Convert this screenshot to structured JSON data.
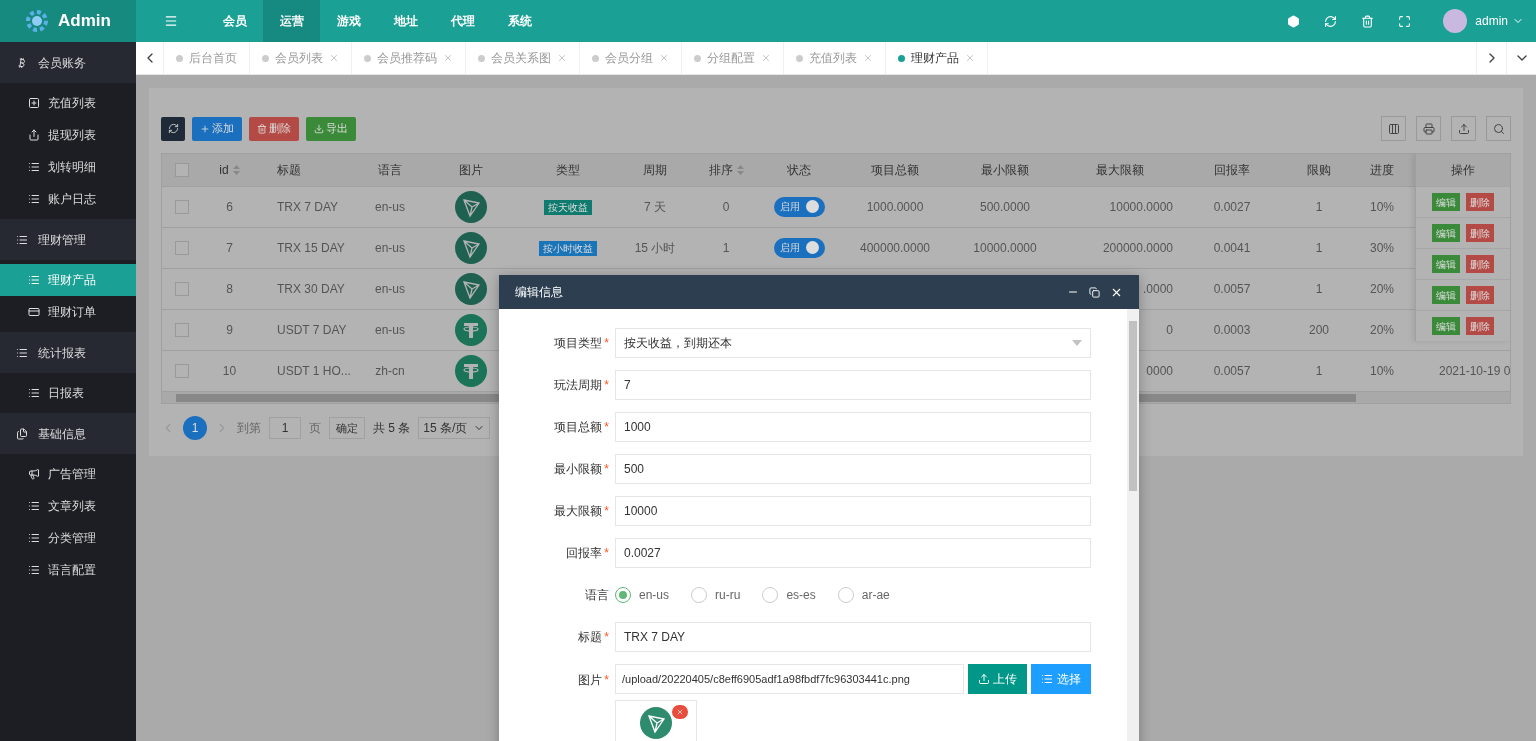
{
  "header": {
    "logo": "Admin",
    "nav": [
      {
        "label": "会员",
        "selected": false
      },
      {
        "label": "运营",
        "selected": true
      },
      {
        "label": "游戏",
        "selected": false
      },
      {
        "label": "地址",
        "selected": false
      },
      {
        "label": "代理",
        "selected": false
      },
      {
        "label": "系统",
        "selected": false
      }
    ],
    "user": "admin"
  },
  "tabs": [
    {
      "label": "后台首页",
      "selected": false,
      "closable": false
    },
    {
      "label": "会员列表",
      "selected": false,
      "closable": true
    },
    {
      "label": "会员推荐码",
      "selected": false,
      "closable": true
    },
    {
      "label": "会员关系图",
      "selected": false,
      "closable": true
    },
    {
      "label": "会员分组",
      "selected": false,
      "closable": true
    },
    {
      "label": "分组配置",
      "selected": false,
      "closable": true
    },
    {
      "label": "充值列表",
      "selected": false,
      "closable": true
    },
    {
      "label": "理财产品",
      "selected": true,
      "closable": true
    }
  ],
  "sidebar": [
    {
      "label": "会员账务",
      "children": [
        {
          "label": "充值列表",
          "selected": false
        },
        {
          "label": "提现列表",
          "selected": false
        },
        {
          "label": "划转明细",
          "selected": false
        },
        {
          "label": "账户日志",
          "selected": false
        }
      ]
    },
    {
      "label": "理财管理",
      "children": [
        {
          "label": "理财产品",
          "selected": true
        },
        {
          "label": "理财订单",
          "selected": false
        }
      ]
    },
    {
      "label": "统计报表",
      "children": [
        {
          "label": "日报表",
          "selected": false
        }
      ]
    },
    {
      "label": "基础信息",
      "children": [
        {
          "label": "广告管理",
          "selected": false
        },
        {
          "label": "文章列表",
          "selected": false
        },
        {
          "label": "分类管理",
          "selected": false
        },
        {
          "label": "语言配置",
          "selected": false
        }
      ]
    }
  ],
  "toolbar": [
    {
      "kind": "add",
      "label": "添加"
    },
    {
      "kind": "delete",
      "label": "删除"
    },
    {
      "kind": "export",
      "label": "导出"
    }
  ],
  "table": {
    "select_all_checked": false,
    "columns": [
      {
        "label": "id",
        "sortable": true
      },
      {
        "label": "标题",
        "sortable": false
      },
      {
        "label": "语言",
        "sortable": false
      },
      {
        "label": "图片",
        "sortable": false
      },
      {
        "label": "类型",
        "sortable": false
      },
      {
        "label": "周期",
        "sortable": false
      },
      {
        "label": "排序",
        "sortable": true
      },
      {
        "label": "状态",
        "sortable": false
      },
      {
        "label": "项目总额",
        "sortable": false
      },
      {
        "label": "最小限额",
        "sortable": false
      },
      {
        "label": "最大限额",
        "sortable": false
      },
      {
        "label": "回报率",
        "sortable": false
      },
      {
        "label": "限购",
        "sortable": false
      },
      {
        "label": "进度",
        "sortable": false
      },
      {
        "label": "操作",
        "sortable": false
      }
    ],
    "rows": [
      {
        "checked": false,
        "id": "6",
        "title": "TRX 7 DAY",
        "lang": "en-us",
        "type": {
          "label": "按天收益",
          "color": "#0f7a6e"
        },
        "period": "7 天",
        "sort": "0",
        "status": {
          "label": "启用",
          "on": true
        },
        "total": "1000.0000",
        "min": "500.0000",
        "max": "10000.0000",
        "rate": "0.0027",
        "limit": "1",
        "progress": "10%"
      },
      {
        "checked": false,
        "id": "7",
        "title": "TRX 15 DAY",
        "lang": "en-us",
        "type": {
          "label": "按小时收益",
          "color": "#1a74b8"
        },
        "period": "15 小时",
        "sort": "1",
        "status": {
          "label": "启用",
          "on": true
        },
        "total": "400000.0000",
        "min": "10000.0000",
        "max": "200000.0000",
        "rate": "0.0041",
        "limit": "1",
        "progress": "30%"
      },
      {
        "checked": false,
        "id": "8",
        "title": "TRX 30 DAY",
        "lang": "en-us",
        "max": ".0000",
        "rate": "0.0057",
        "limit": "1",
        "progress": "20%"
      },
      {
        "checked": false,
        "id": "9",
        "title": "USDT 7 DAY",
        "lang": "en-us",
        "max": "0",
        "rate": "0.0003",
        "limit": "200",
        "progress": "20%"
      },
      {
        "checked": false,
        "id": "10",
        "title": "USDT 1 HO...",
        "lang": "zh-cn",
        "max": "0000",
        "rate": "0.0057",
        "limit": "1",
        "progress": "10%",
        "column_15": "2021-10-19 0"
      }
    ],
    "actions": [
      {
        "edit": "编辑",
        "delete": "删除"
      },
      {
        "edit": "编辑",
        "delete": "删除"
      },
      {
        "edit": "编辑",
        "delete": "删除"
      },
      {
        "edit": "编辑",
        "delete": "删除"
      },
      {
        "edit": "编辑",
        "delete": "删除"
      }
    ]
  },
  "pagination": {
    "current": "1",
    "goto": "到第",
    "page_input": "1",
    "page_unit": "页",
    "confirm": "确定",
    "total": "共 5 条",
    "page_size": "15 条/页"
  },
  "modal": {
    "title": "编辑信息",
    "fields": [
      {
        "kind": "select",
        "label": "项目类型",
        "required_mark": "*",
        "value": "按天收益，到期还本"
      },
      {
        "kind": "input",
        "label": "玩法周期",
        "required_mark": "*",
        "value": "7"
      },
      {
        "kind": "input",
        "label": "项目总额",
        "required_mark": "*",
        "value": "1000"
      },
      {
        "kind": "input",
        "label": "最小限额",
        "required_mark": "*",
        "value": "500"
      },
      {
        "kind": "input",
        "label": "最大限额",
        "required_mark": "*",
        "value": "10000"
      },
      {
        "kind": "input",
        "label": "回报率",
        "required_mark": "*",
        "value": "0.0027"
      },
      {
        "kind": "radio",
        "label": "语言",
        "options": [
          {
            "label": "en-us",
            "selected": true
          },
          {
            "label": "ru-ru",
            "selected": false
          },
          {
            "label": "es-es",
            "selected": false
          },
          {
            "label": "ar-ae",
            "selected": false
          }
        ]
      },
      {
        "kind": "input",
        "label": "标题",
        "required_mark": "*",
        "value": "TRX 7 DAY"
      },
      {
        "kind": "file",
        "label": "图片",
        "required_mark": "*",
        "value": "/upload/20220405/c8eff6905adf1a98fbdf7fc96303441c.png",
        "upload": "上传",
        "choose": "选择"
      }
    ]
  }
}
